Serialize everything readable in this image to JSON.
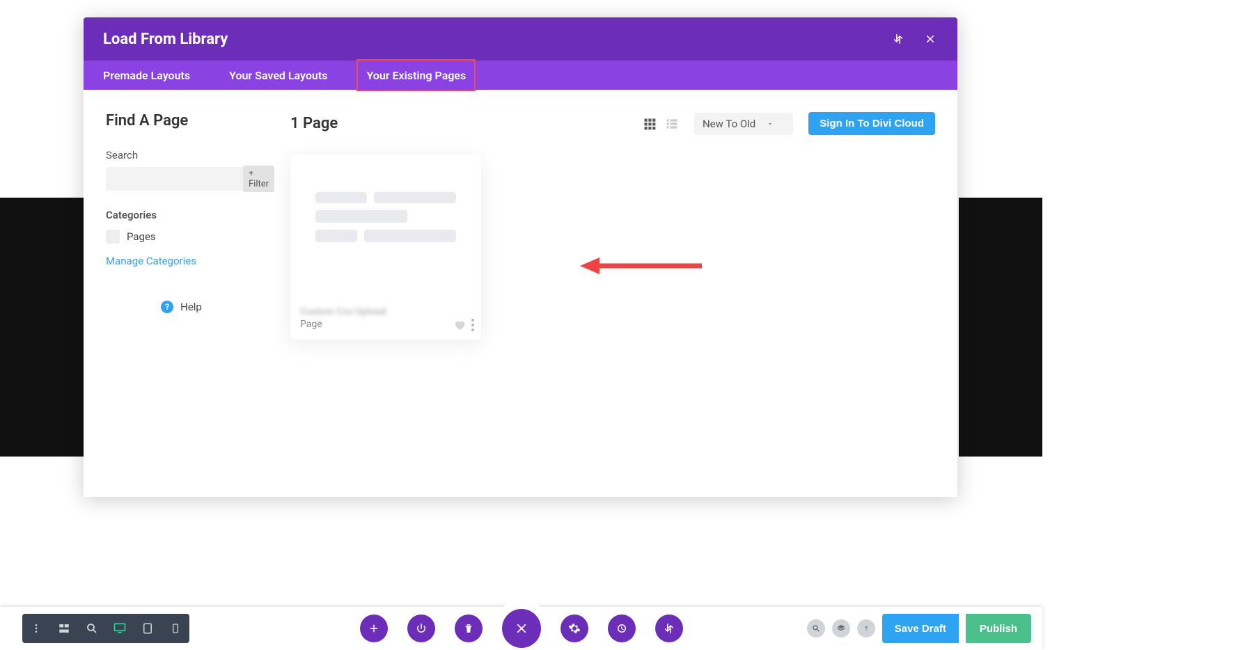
{
  "modal": {
    "title": "Load From Library",
    "tabs": {
      "premade": "Premade Layouts",
      "saved": "Your Saved Layouts",
      "existing": "Your Existing Pages"
    },
    "sidebar": {
      "heading": "Find A Page",
      "search_label": "Search",
      "search_placeholder": "",
      "filter_btn": "+ Filter",
      "categories_heading": "Categories",
      "cat_pages": "Pages",
      "manage_link": "Manage Categories",
      "help": "Help"
    },
    "main": {
      "count_label": "1 Page",
      "sort_value": "New To Old",
      "signin_btn": "Sign In To Divi Cloud",
      "card_title_blurred": "Custom Css Upload",
      "card_type": "Page"
    }
  },
  "bottom": {
    "save_draft": "Save Draft",
    "publish": "Publish"
  }
}
